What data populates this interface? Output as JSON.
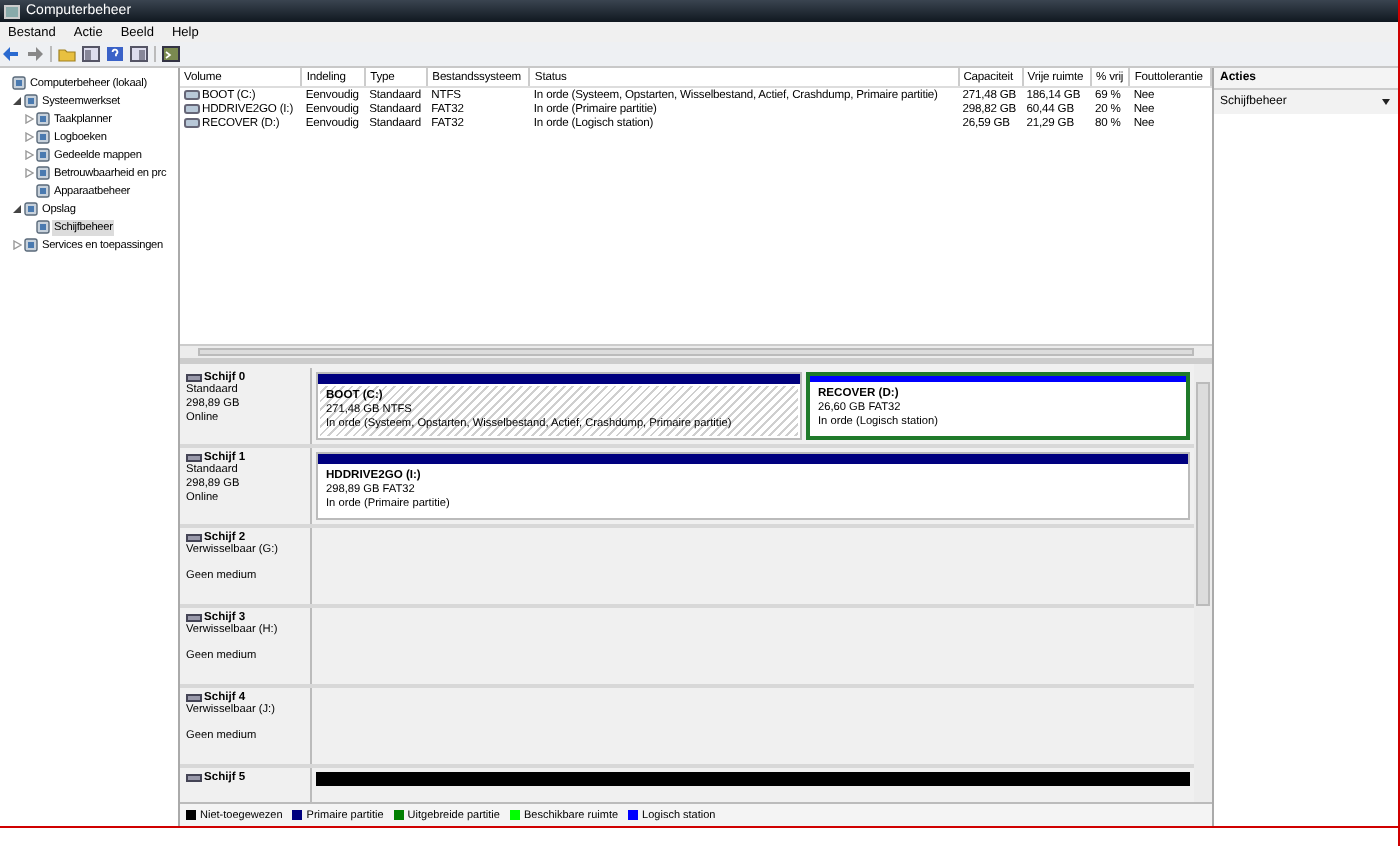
{
  "window": {
    "title": "Computerbeheer"
  },
  "menu": [
    "Bestand",
    "Actie",
    "Beeld",
    "Help"
  ],
  "tree": [
    {
      "label": "Computerbeheer (lokaal)",
      "selected": false,
      "children": [
        {
          "label": "Systeemwerkset",
          "selected": false,
          "expanded": true,
          "children": [
            {
              "label": "Taakplanner",
              "selected": false,
              "expanded": false
            },
            {
              "label": "Logboeken",
              "selected": false,
              "expanded": false
            },
            {
              "label": "Gedeelde mappen",
              "selected": false,
              "expanded": false
            },
            {
              "label": "Betrouwbaarheid en prc",
              "selected": false,
              "expanded": false
            },
            {
              "label": "Apparaatbeheer",
              "selected": false
            }
          ]
        },
        {
          "label": "Opslag",
          "selected": false,
          "expanded": true,
          "children": [
            {
              "label": "Schijfbeheer",
              "selected": true
            }
          ]
        },
        {
          "label": "Services en toepassingen",
          "selected": false,
          "expanded": false
        }
      ]
    }
  ],
  "volumes": {
    "columns": [
      "Volume",
      "Indeling",
      "Type",
      "Bestandssysteem",
      "Status",
      "Capaciteit",
      "Vrije ruimte",
      "% vrij",
      "Fouttolerantie"
    ],
    "rows": [
      [
        "BOOT (C:)",
        "Eenvoudig",
        "Standaard",
        "NTFS",
        "In orde (Systeem, Opstarten, Wisselbestand, Actief, Crashdump, Primaire partitie)",
        "271,48 GB",
        "186,14 GB",
        "69 %",
        "Nee"
      ],
      [
        "HDDRIVE2GO (I:)",
        "Eenvoudig",
        "Standaard",
        "FAT32",
        "In orde (Primaire partitie)",
        "298,82 GB",
        "60,44 GB",
        "20 %",
        "Nee"
      ],
      [
        "RECOVER (D:)",
        "Eenvoudig",
        "Standaard",
        "FAT32",
        "In orde (Logisch station)",
        "26,59 GB",
        "21,29 GB",
        "80 %",
        "Nee"
      ]
    ]
  },
  "disks": [
    {
      "name": "Schijf 0",
      "type": "Standaard",
      "size": "298,89 GB",
      "status": "Online",
      "partitions": [
        {
          "kind": "primary",
          "selected": true,
          "name": "BOOT  (C:)",
          "size": "271,48 GB NTFS",
          "status": "In orde (Systeem, Opstarten, Wisselbestand, Actief, Crashdump, Primaire partitie)"
        },
        {
          "kind": "logical",
          "selected": false,
          "name": "RECOVER  (D:)",
          "size": "26,60 GB FAT32",
          "status": "In orde (Logisch station)"
        }
      ]
    },
    {
      "name": "Schijf 1",
      "type": "Standaard",
      "size": "298,89 GB",
      "status": "Online",
      "partitions": [
        {
          "kind": "primary",
          "selected": false,
          "name": "HDDRIVE2GO  (I:)",
          "size": "298,89 GB FAT32",
          "status": "In orde (Primaire partitie)"
        }
      ]
    },
    {
      "name": "Schijf 2",
      "type": "Verwisselbaar (G:)",
      "status": "Geen medium"
    },
    {
      "name": "Schijf 3",
      "type": "Verwisselbaar (H:)",
      "status": "Geen medium"
    },
    {
      "name": "Schijf 4",
      "type": "Verwisselbaar (J:)",
      "status": "Geen medium"
    },
    {
      "name": "Schijf 5",
      "partitions": [
        {
          "kind": "unallocated"
        }
      ]
    }
  ],
  "legend": [
    {
      "label": "Niet-toegewezen",
      "color": "#000000"
    },
    {
      "label": "Primaire partitie",
      "color": "#00007f"
    },
    {
      "label": "Uitgebreide partitie",
      "color": "#007f00"
    },
    {
      "label": "Beschikbare ruimte",
      "color": "#00ff00"
    },
    {
      "label": "Logisch station",
      "color": "#0000ff"
    }
  ],
  "actions": {
    "title": "Acties",
    "items": [
      "Schijfbeheer"
    ]
  }
}
